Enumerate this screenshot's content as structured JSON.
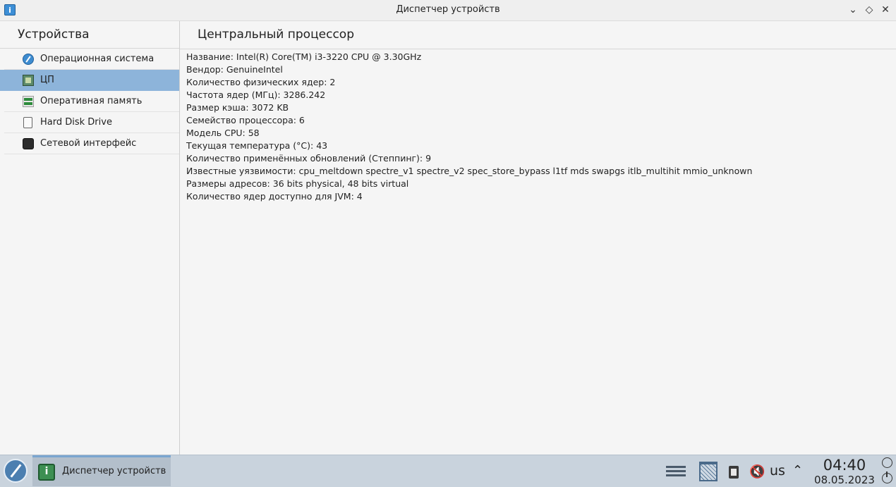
{
  "window": {
    "title": "Диспетчер устройств",
    "controls": [
      "minimize-icon",
      "maximize-icon",
      "close-icon"
    ]
  },
  "sidebar": {
    "header": "Устройства",
    "items": [
      {
        "label": "Операционная система",
        "icon": "os-icon",
        "selected": false
      },
      {
        "label": "ЦП",
        "icon": "cpu-icon",
        "selected": true
      },
      {
        "label": "Оперативная память",
        "icon": "ram-icon",
        "selected": false
      },
      {
        "label": "Hard Disk Drive",
        "icon": "hdd-icon",
        "selected": false
      },
      {
        "label": "Сетевой интерфейс",
        "icon": "network-icon",
        "selected": false
      }
    ]
  },
  "main": {
    "title": "Центральный процессор",
    "properties": [
      "Название: Intel(R) Core(TM) i3-3220 CPU @ 3.30GHz",
      "Вендор: GenuineIntel",
      "Количество физических ядер: 2",
      "Частота ядер (МГц): 3286.242",
      "Размер кэша: 3072 KB",
      "Семейство процессора: 6",
      "Модель CPU: 58",
      "Текущая температура (°C): 43",
      "Количество применённых обновлений (Степпинг): 9",
      "Известные уязвимости: cpu_meltdown spectre_v1 spectre_v2 spec_store_bypass l1tf mds swapgs itlb_multihit mmio_unknown",
      "Размеры адресов: 36 bits physical, 48 bits virtual",
      "Количество ядер доступно для JVM: 4"
    ]
  },
  "taskbar": {
    "task_label": "Диспетчер устройств",
    "keyboard_layout": "us",
    "time": "04:40",
    "date": "08.05.2023"
  },
  "colors": {
    "selection": "#8db4da",
    "taskbar": "#c9d3dd",
    "background": "#f5f5f5"
  }
}
